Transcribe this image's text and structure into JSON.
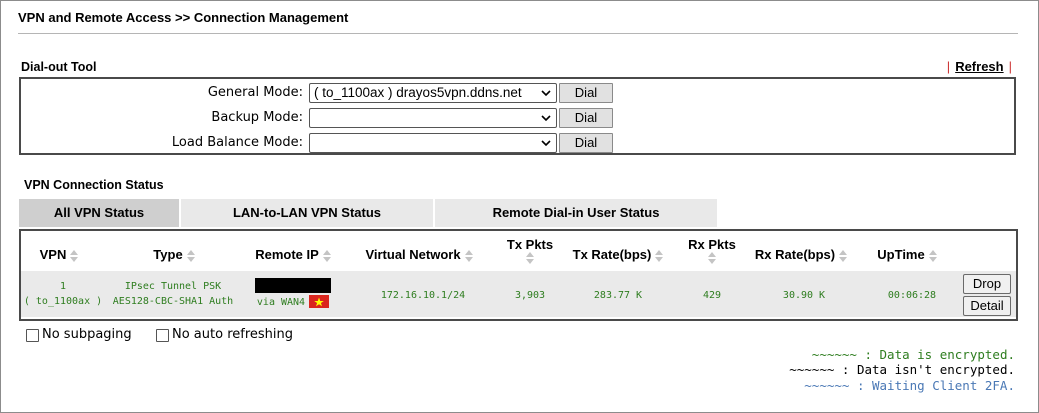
{
  "page_title": "VPN and Remote Access >> Connection Management",
  "dial_tool": {
    "title": "Dial-out Tool",
    "refresh_label": "Refresh",
    "separator": "|",
    "rows": [
      {
        "label": "General Mode:",
        "selected": "( to_1100ax ) drayos5vpn.ddns.net",
        "button": "Dial"
      },
      {
        "label": "Backup Mode:",
        "selected": "",
        "button": "Dial"
      },
      {
        "label": "Load Balance Mode:",
        "selected": "",
        "button": "Dial"
      }
    ]
  },
  "vpn_status": {
    "title": "VPN Connection Status",
    "tabs": [
      {
        "label": "All VPN Status",
        "active": true
      },
      {
        "label": "LAN-to-LAN VPN Status",
        "active": false
      },
      {
        "label": "Remote Dial-in User Status",
        "active": false
      }
    ],
    "columns": [
      "VPN",
      "Type",
      "Remote IP",
      "Virtual Network",
      "Tx Pkts",
      "Tx Rate(bps)",
      "Rx Pkts",
      "Rx Rate(bps)",
      "UpTime"
    ],
    "rows": [
      {
        "vpn_index": "1",
        "vpn_name": "( to_1100ax )",
        "type_line1": "IPsec Tunnel PSK",
        "type_line2": "AES128-CBC-SHA1 Auth",
        "remote_ip_via": "via WAN4",
        "virtual_network": "172.16.10.1/24",
        "tx_pkts": "3,903",
        "tx_rate": "283.77 K",
        "rx_pkts": "429",
        "rx_rate": "30.90 K",
        "uptime": "00:06:28",
        "drop_label": "Drop",
        "detail_label": "Detail"
      }
    ]
  },
  "options": {
    "no_subpaging": "No subpaging",
    "no_auto_refresh": "No auto refreshing"
  },
  "legend": [
    {
      "tilde": "~~~~~~",
      "text": " : Data is encrypted.",
      "color": "#2e7d1f"
    },
    {
      "tilde": "~~~~~~",
      "text": " : Data isn't encrypted.",
      "color": "#000000"
    },
    {
      "tilde": "~~~~~~",
      "text": " : Waiting Client 2FA.",
      "color": "#4a78b5"
    }
  ],
  "colors": {
    "encrypted_green": "#2e7d1f",
    "waiting_blue": "#4a78b5",
    "refresh_separator": "#cc3333"
  }
}
